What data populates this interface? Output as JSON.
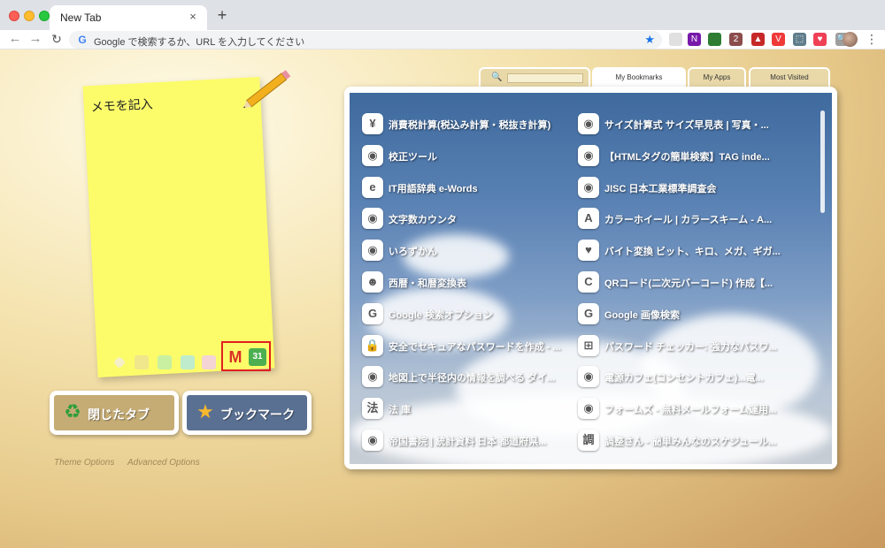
{
  "browser": {
    "tab_title": "New Tab",
    "tab_close": "×",
    "new_tab": "+",
    "omnibox_text": "Google で検索するか、URL を入力してください",
    "google_g": "G",
    "back": "←",
    "forward": "→",
    "reload": "↻",
    "star": "★",
    "kebab": "⋮",
    "extensions": [
      {
        "name": "extension-1-icon",
        "color": "#e0e0e0",
        "glyph": ""
      },
      {
        "name": "onenote-icon",
        "color": "#7719aa",
        "glyph": "N"
      },
      {
        "name": "extension-3-icon",
        "color": "#2e7d32",
        "glyph": ""
      },
      {
        "name": "extension-4-icon",
        "color": "#8b4c4c",
        "glyph": "2"
      },
      {
        "name": "extension-5-icon",
        "color": "#c62828",
        "glyph": "▲"
      },
      {
        "name": "vivaldi-icon",
        "color": "#ef3939",
        "glyph": "V"
      },
      {
        "name": "capture-icon",
        "color": "#607d8b",
        "glyph": "⬚"
      },
      {
        "name": "pocket-icon",
        "color": "#ef4056",
        "glyph": "♥"
      },
      {
        "name": "zoom-icon",
        "color": "#9e9e9e",
        "glyph": "🔍"
      }
    ]
  },
  "memo": {
    "placeholder": "メモを記入"
  },
  "quick_icons": {
    "gmail": "M",
    "calendar": "31"
  },
  "buttons": {
    "closed_tabs": {
      "label": "閉じたタブ",
      "icon": "♻"
    },
    "bookmarks": {
      "label": "ブックマーク",
      "icon": "★"
    }
  },
  "options": {
    "theme": "Theme Options",
    "advanced": "Advanced Options"
  },
  "panel_tabs": {
    "search_icon": "🔍",
    "bookmarks": "My Bookmarks",
    "apps": "My Apps",
    "most_visited": "Most Visited"
  },
  "bookmarks_left": [
    {
      "label": "消費税計算(税込み計算・税抜き計算)",
      "icon": "¥",
      "icon_name": "yen-icon"
    },
    {
      "label": "校正ツール",
      "icon": "◉",
      "icon_name": "globe-icon"
    },
    {
      "label": "IT用語辞典 e-Words",
      "icon": "e",
      "icon_name": "e-words-icon"
    },
    {
      "label": "文字数カウンタ",
      "icon": "◉",
      "icon_name": "globe-icon"
    },
    {
      "label": "いろずかん",
      "icon": "◉",
      "icon_name": "globe-icon"
    },
    {
      "label": "西暦・和暦変換表",
      "icon": "☻",
      "icon_name": "penguin-icon"
    },
    {
      "label": "Google 検索オプション",
      "icon": "G",
      "icon_name": "google-icon"
    },
    {
      "label": "安全でセキュアなパスワードを作成 - ...",
      "icon": "🔒",
      "icon_name": "lock-icon"
    },
    {
      "label": "地図上で半径内の情報を調べる ダイ...",
      "icon": "◉",
      "icon_name": "globe-icon"
    },
    {
      "label": "法 庫",
      "icon": "法",
      "icon_name": "houko-icon"
    },
    {
      "label": "帝国書院 | 統計資料 日本 都道府県...",
      "icon": "◉",
      "icon_name": "globe-icon"
    }
  ],
  "bookmarks_right": [
    {
      "label": "サイズ計算式 サイズ早見表 | 写真・...",
      "icon": "◉",
      "icon_name": "globe-icon"
    },
    {
      "label": "【HTMLタグの簡単検索】TAG inde...",
      "icon": "◉",
      "icon_name": "globe-icon"
    },
    {
      "label": "JISC 日本工業標準調査会",
      "icon": "◉",
      "icon_name": "globe-icon"
    },
    {
      "label": "カラーホイール | カラースキーム - A...",
      "icon": "A",
      "icon_name": "adobe-icon"
    },
    {
      "label": "バイト変換 ビット、キロ、メガ、ギガ...",
      "icon": "♥",
      "icon_name": "heart-icon"
    },
    {
      "label": "QRコード(二次元バーコード) 作成【...",
      "icon": "C",
      "icon_name": "qr-c-icon"
    },
    {
      "label": "Google 画像検索",
      "icon": "G",
      "icon_name": "google-icon"
    },
    {
      "label": "パスワード チェッカー: 強力なパスワ...",
      "icon": "⊞",
      "icon_name": "microsoft-icon"
    },
    {
      "label": "電源カフェ(コンセントカフェ)...電...",
      "icon": "◉",
      "icon_name": "globe-icon"
    },
    {
      "label": "フォームズ - 無料メールフォーム運用...",
      "icon": "◉",
      "icon_name": "globe-icon"
    },
    {
      "label": "調整さん - 簡単みんなのスケジュール...",
      "icon": "調",
      "icon_name": "chousei-icon"
    }
  ]
}
